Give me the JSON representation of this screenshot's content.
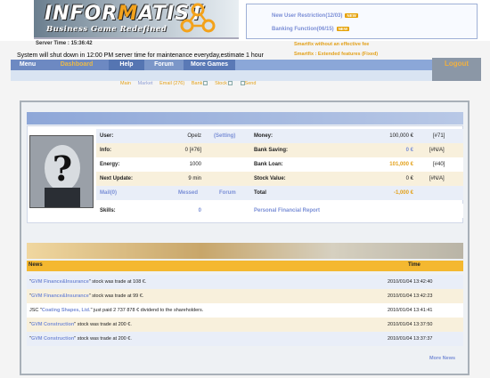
{
  "header": {
    "logo_prefix": "INFOR",
    "logo_m": "M",
    "logo_suffix": "ATIST",
    "tagline": "Business Game Redefined",
    "notice_1": "New User Restriction(12/03)",
    "notice_2": "Banking Function(06/15)",
    "new_badge": "NEW",
    "server_time_label": "Server Time : 15:36:42",
    "maintenance": "System will shut down in 12:00 PM server time for maintenance everyday,estimate 1 hour",
    "orange_link_1": "Smartfix without an effective fee",
    "orange_link_2": "Smartfix : Extended features (Fixed)"
  },
  "nav": {
    "menu": "Menu",
    "dashboard": "Dashboard",
    "help": "Help",
    "forum": "Forum",
    "more_games": "More Games",
    "logout": "Logout"
  },
  "subnav": {
    "items": [
      "Main",
      "Market",
      "Email (276)",
      "Bank",
      "Stock",
      "Send"
    ]
  },
  "profile": {
    "user_label": "User:",
    "user_value": "Opelz",
    "setting_link": "(Setting)",
    "info_label": "Info:",
    "info_value": "0 [#76]",
    "energy_label": "Energy:",
    "energy_value": "1000",
    "next_update_label": "Next Update:",
    "next_update_value": "9 min",
    "mail_link": "Mail(0)",
    "messed_link": "Messed",
    "forum_link": "Forum",
    "skills_label": "Skills:",
    "skills_value": "0",
    "money_label": "Money:",
    "money_value": "100,000 €",
    "money_rank": "[#71]",
    "bank_saving_label": "Bank Saving:",
    "bank_saving_value": "0 €",
    "bank_saving_rank": "[#N/A]",
    "bank_loan_label": "Bank Loan:",
    "bank_loan_value": "101,000 €",
    "bank_loan_rank": "[#40]",
    "stock_value_label": "Stock Value:",
    "stock_value_value": "0 €",
    "stock_value_rank": "[#N/A]",
    "total_label": "Total",
    "total_value": "-1,000 €",
    "personal_report_link": "Personal Financial Report"
  },
  "news": {
    "header_news": "News",
    "header_time": "Time",
    "rows": [
      {
        "pre": "\"",
        "link": "GVM Finance&Insurance",
        "post": "\" stock was trade at 108 €.",
        "time": "2010/01/04 13:42:40"
      },
      {
        "pre": "\"",
        "link": "GVM Finance&Insurance",
        "post": "\" stock was trade at 99 €.",
        "time": "2010/01/04 13:42:23"
      },
      {
        "pre": "JSC \"",
        "link": "Coating Shapes, Ltd.",
        "post": "\" just paid 2 737 878 € dividend to the shareholders.",
        "time": "2010/01/04 13:41:41"
      },
      {
        "pre": "\"",
        "link": "GVM Construction",
        "post": "\" stock was trade at 200 €.",
        "time": "2010/01/04 13:37:50"
      },
      {
        "pre": "\"",
        "link": "GVM Construction",
        "post": "\" stock was trade at 200 €.",
        "time": "2010/01/04 13:37:37"
      }
    ],
    "more_news": "More News"
  },
  "colors": {
    "accent_orange": "#e3a11a",
    "nav_blue": "#6d89c2",
    "link_blue": "#7a8fd6"
  },
  "icons": {
    "logo_symbol": "molecule-logo-icon",
    "avatar": "question-mark-avatar"
  }
}
